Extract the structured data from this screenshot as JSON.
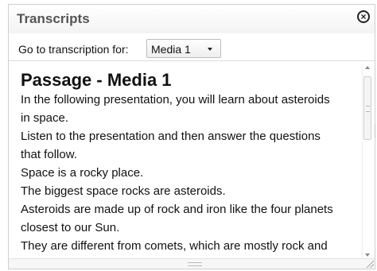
{
  "dialog": {
    "title": "Transcripts",
    "close_icon": "close-circle-icon"
  },
  "goto": {
    "label": "Go to transcription for:",
    "selected": "Media 1"
  },
  "passage": {
    "title": "Passage - Media 1",
    "lines": [
      "In the following presentation, you will learn about asteroids",
      "in space.",
      "Listen to the presentation and then answer the questions",
      "that follow.",
      "Space is a rocky place.",
      "The biggest space rocks are asteroids.",
      "Asteroids are made up of rock and iron like the four planets",
      "closest to our Sun.",
      "They are different from comets, which are mostly rock and"
    ]
  }
}
